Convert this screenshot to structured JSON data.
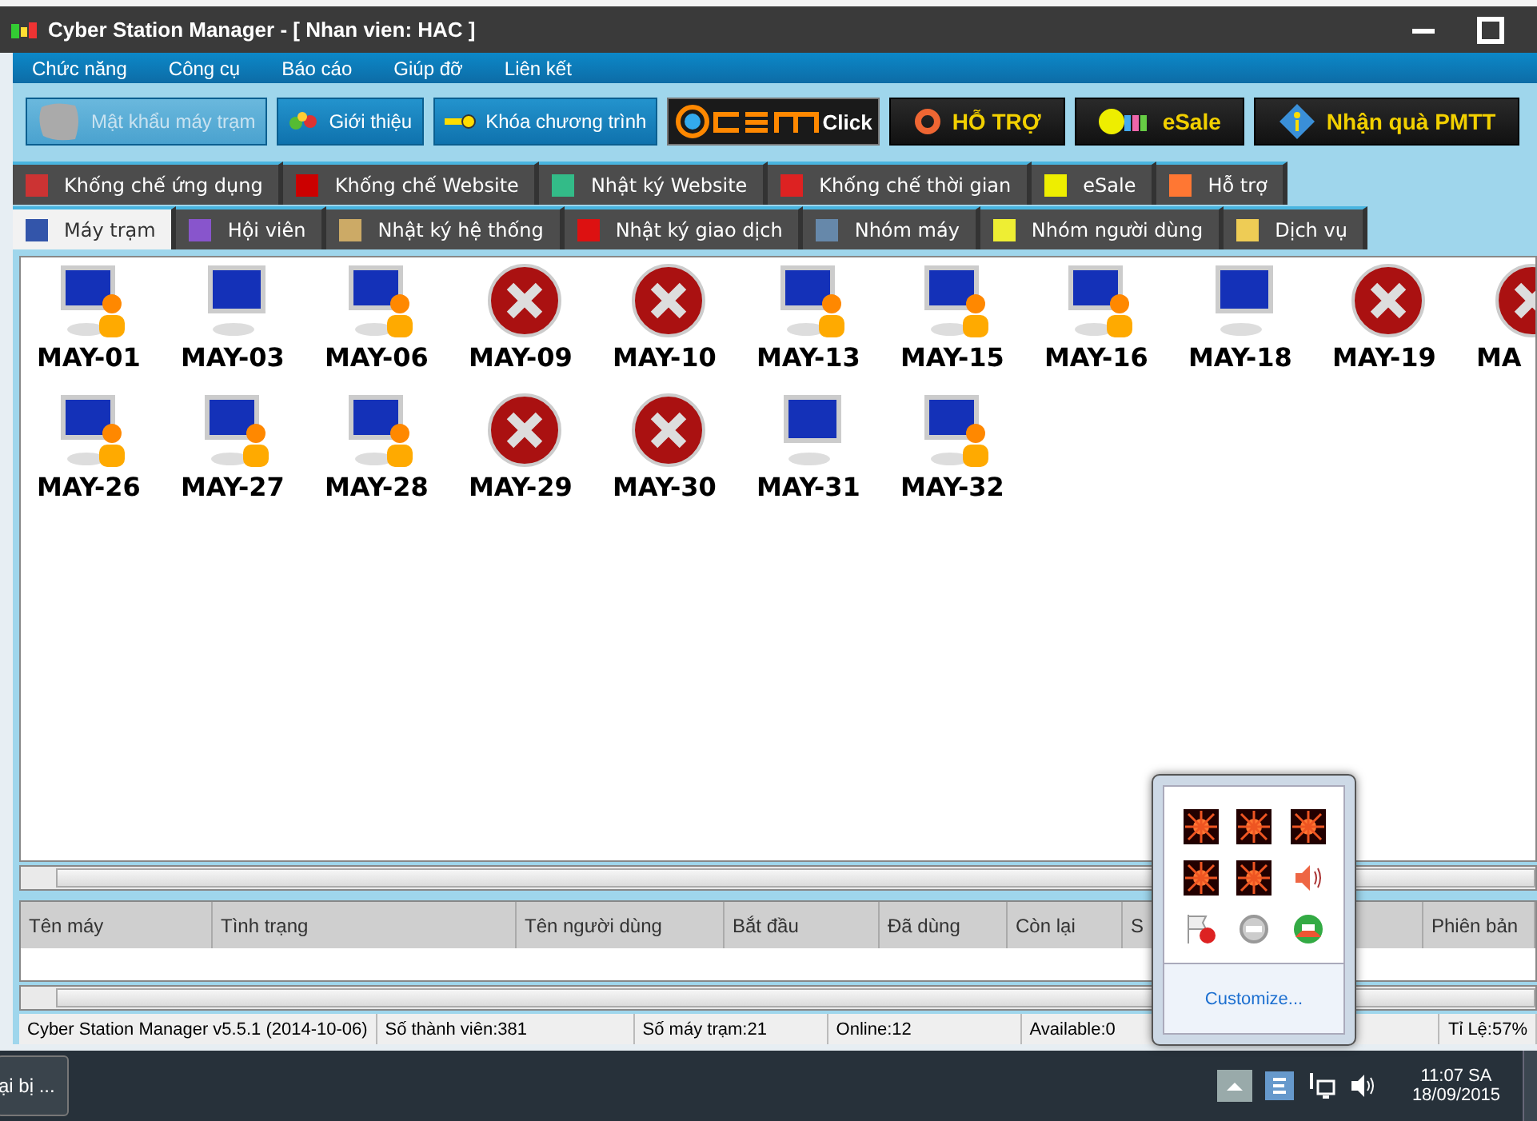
{
  "window": {
    "title": "Cyber Station Manager - [ Nhan vien: HAC ]"
  },
  "menu": [
    "Chức năng",
    "Công cụ",
    "Báo cáo",
    "Giúp đỡ",
    "Liên kết"
  ],
  "toolbar": [
    {
      "label": "Mật khẩu máy trạm",
      "kind": "blue",
      "disabled": true
    },
    {
      "label": "Giới thiệu",
      "kind": "blue",
      "disabled": false
    },
    {
      "label": "Khóa chương trình",
      "kind": "blue",
      "disabled": false
    },
    {
      "label": "Click",
      "kind": "csm",
      "disabled": false
    },
    {
      "label": "HỖ TRỢ",
      "kind": "dark",
      "disabled": false
    },
    {
      "label": "eSale",
      "kind": "dark",
      "disabled": false
    },
    {
      "label": "Nhận quà PMTT",
      "kind": "dark",
      "disabled": false
    }
  ],
  "tabs_top": [
    {
      "label": "Khống chế ứng dụng",
      "selected": false
    },
    {
      "label": "Khống chế Website",
      "selected": false
    },
    {
      "label": "Nhật ký Website",
      "selected": false
    },
    {
      "label": "Khống chế thời gian",
      "selected": false
    },
    {
      "label": "eSale",
      "selected": false
    },
    {
      "label": "Hỗ trợ",
      "selected": false
    }
  ],
  "tabs_bottom": [
    {
      "label": "Máy trạm",
      "selected": true
    },
    {
      "label": "Hội viên",
      "selected": false
    },
    {
      "label": "Nhật ký hệ thống",
      "selected": false
    },
    {
      "label": "Nhật ký giao dịch",
      "selected": false
    },
    {
      "label": "Nhóm máy",
      "selected": false
    },
    {
      "label": "Nhóm người dùng",
      "selected": false
    },
    {
      "label": "Dịch vụ",
      "selected": false
    }
  ],
  "machines": [
    {
      "name": "MAY-01",
      "kind": "user"
    },
    {
      "name": "MAY-03",
      "kind": "idle"
    },
    {
      "name": "MAY-06",
      "kind": "user"
    },
    {
      "name": "MAY-09",
      "kind": "off"
    },
    {
      "name": "MAY-10",
      "kind": "off"
    },
    {
      "name": "MAY-13",
      "kind": "user"
    },
    {
      "name": "MAY-15",
      "kind": "user"
    },
    {
      "name": "MAY-16",
      "kind": "user"
    },
    {
      "name": "MAY-18",
      "kind": "idle"
    },
    {
      "name": "MAY-19",
      "kind": "off"
    },
    {
      "name": "MA",
      "kind": "off"
    },
    {
      "name": "MAY-26",
      "kind": "user"
    },
    {
      "name": "MAY-27",
      "kind": "user"
    },
    {
      "name": "MAY-28",
      "kind": "user"
    },
    {
      "name": "MAY-29",
      "kind": "off"
    },
    {
      "name": "MAY-30",
      "kind": "off"
    },
    {
      "name": "MAY-31",
      "kind": "idle"
    },
    {
      "name": "MAY-32",
      "kind": "user"
    }
  ],
  "table": {
    "columns": [
      "Tên máy",
      "Tình trạng",
      "Tên người dùng",
      "Bắt đầu",
      "Đã dùng",
      "Còn lại",
      "S",
      "Phiên bản"
    ]
  },
  "status_bar": [
    "Cyber Station Manager v5.5.1 (2014-10-06)",
    "Số thành viên:381",
    "Số máy trạm:21",
    "Online:12",
    "Available:0",
    "Tỉ Lệ:57%"
  ],
  "taskbar": {
    "button": "ại bị ...",
    "time": "11:07 SA",
    "date": "18/09/2015"
  },
  "tray_popup": {
    "link": "Customize..."
  }
}
